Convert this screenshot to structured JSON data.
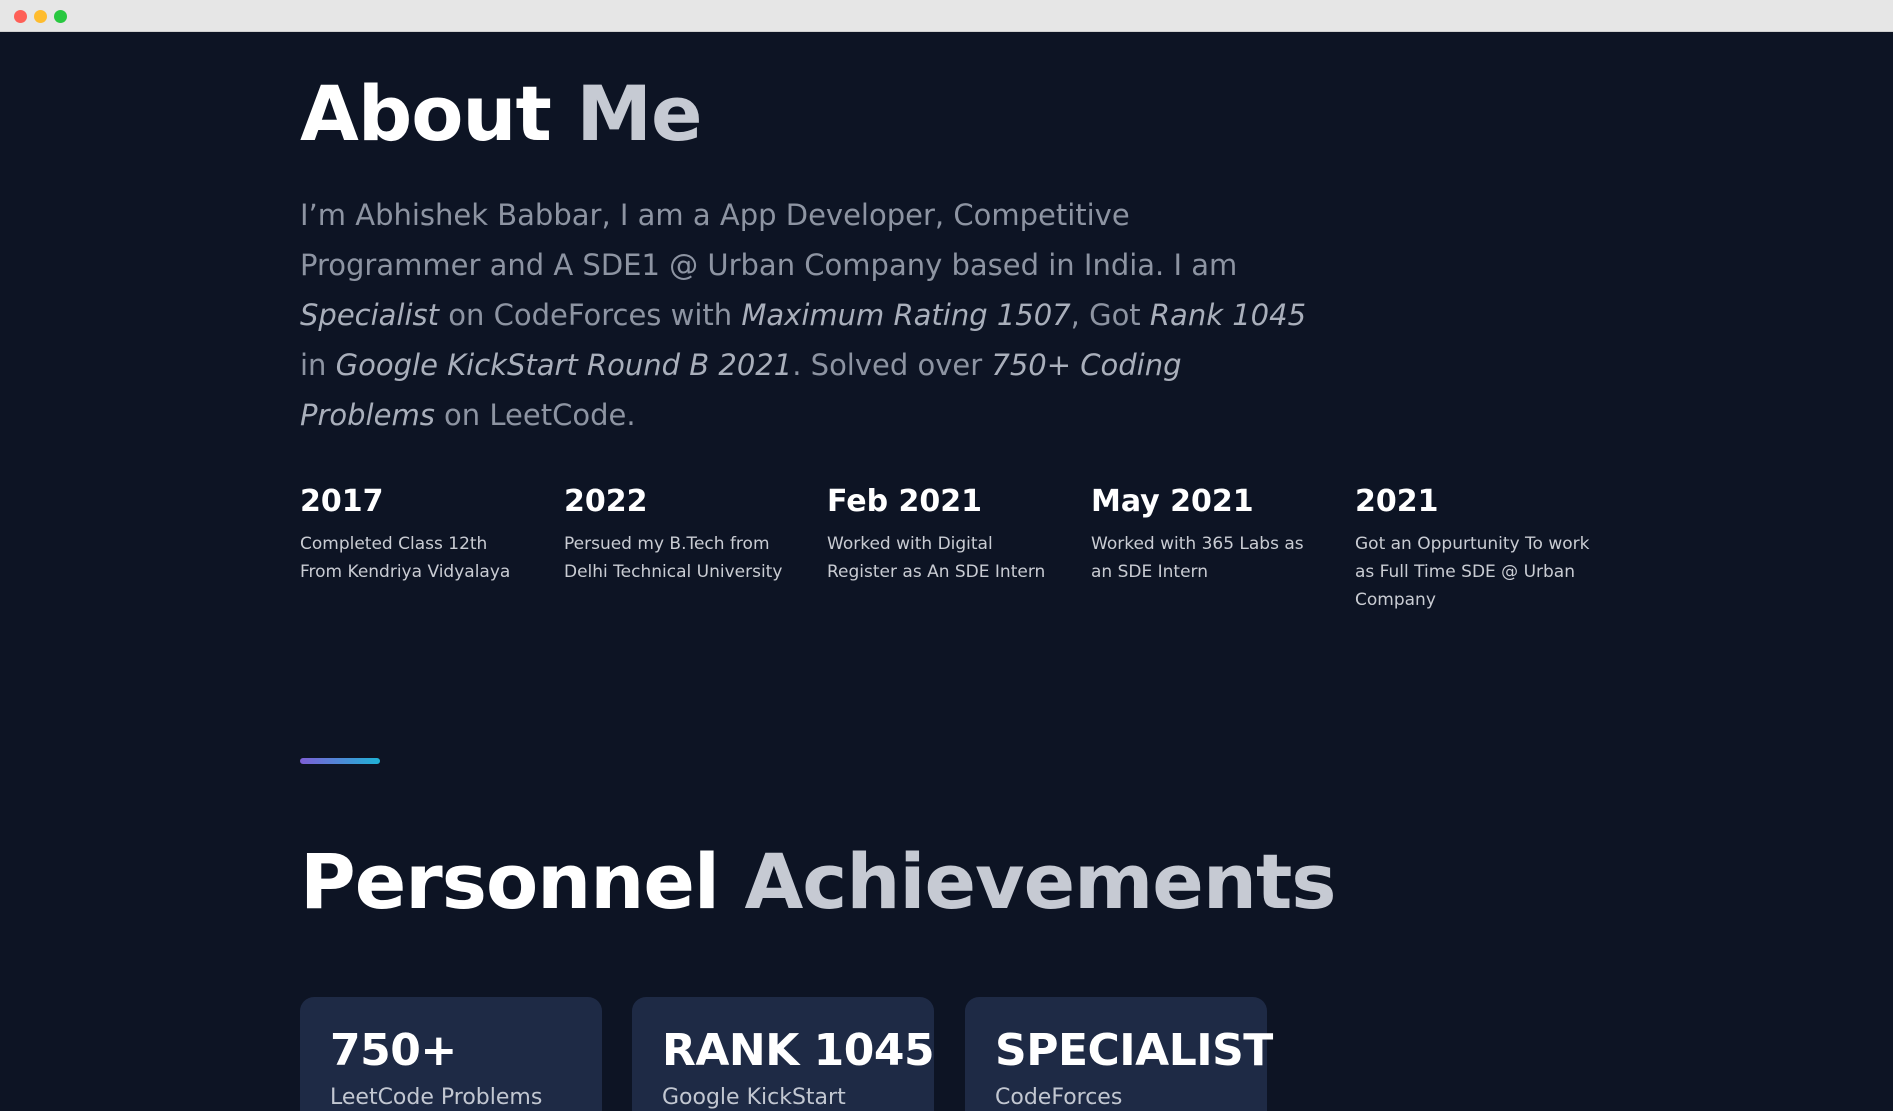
{
  "about": {
    "title_part1": "About",
    "title_part2": "Me",
    "bio": [
      {
        "text": "I’m Abhishek Babbar, I am a App Developer, Competitive Programmer and A SDE1 @ Urban Company based in India. I am ",
        "em": false
      },
      {
        "text": "Specialist",
        "em": true
      },
      {
        "text": " on CodeForces with ",
        "em": false
      },
      {
        "text": "Maximum Rating 1507",
        "em": true
      },
      {
        "text": ", Got ",
        "em": false
      },
      {
        "text": "Rank 1045",
        "em": true
      },
      {
        "text": " in ",
        "em": false
      },
      {
        "text": "Google KickStart Round B 2021",
        "em": true
      },
      {
        "text": ". Solved over ",
        "em": false
      },
      {
        "text": "750+ Coding Problems",
        "em": true
      },
      {
        "text": " on LeetCode.",
        "em": false
      }
    ]
  },
  "timeline": [
    {
      "year": "2017",
      "desc": "Completed Class 12th From Kendriya Vidyalaya"
    },
    {
      "year": "2022",
      "desc": "Persued my B.Tech from Delhi Technical University"
    },
    {
      "year": "Feb 2021",
      "desc": "Worked with Digital Register as An SDE Intern"
    },
    {
      "year": "May 2021",
      "desc": "Worked with 365 Labs as an SDE Intern"
    },
    {
      "year": "2021",
      "desc": "Got an Oppurtunity To work as Full Time SDE @ Urban Company"
    }
  ],
  "achievements": {
    "title_part1": "Personnel",
    "title_part2": "Achievements",
    "cards": [
      {
        "value": "750+",
        "label": "LeetCode Problems"
      },
      {
        "value": "RANK 1045",
        "label": "Google KickStart"
      },
      {
        "value": "SPECIALIST",
        "label": "CodeForces"
      }
    ]
  },
  "colors": {
    "background": "#0d1424",
    "card": "#1e2a45",
    "accent_start": "#7d5fd6",
    "accent_end": "#1fb3d6"
  }
}
